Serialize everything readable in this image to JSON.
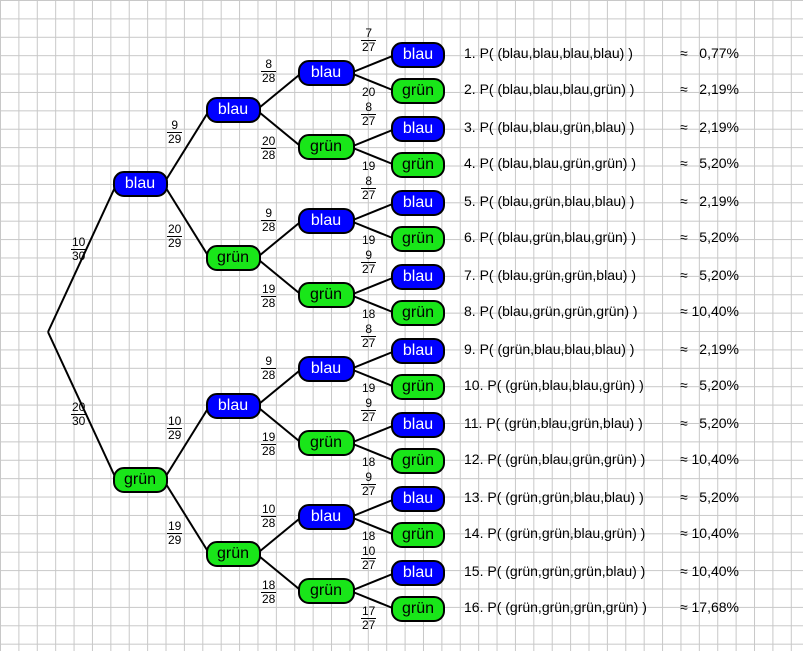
{
  "root_edges": [
    {
      "num": "10",
      "den": "30"
    },
    {
      "num": "20",
      "den": "30"
    }
  ],
  "level1": [
    {
      "label": "blau",
      "color": "blau"
    },
    {
      "label": "grün",
      "color": "gruen"
    }
  ],
  "level1_edges": [
    {
      "num": "9",
      "den": "29"
    },
    {
      "num": "20",
      "den": "29"
    },
    {
      "num": "10",
      "den": "29"
    },
    {
      "num": "19",
      "den": "29"
    }
  ],
  "level2": [
    {
      "label": "blau",
      "color": "blau"
    },
    {
      "label": "grün",
      "color": "gruen"
    },
    {
      "label": "blau",
      "color": "blau"
    },
    {
      "label": "grün",
      "color": "gruen"
    }
  ],
  "level2_edges": [
    {
      "num": "8",
      "den": "28"
    },
    {
      "num": "20",
      "den": "28"
    },
    {
      "num": "9",
      "den": "28"
    },
    {
      "num": "19",
      "den": "28"
    },
    {
      "num": "9",
      "den": "28"
    },
    {
      "num": "19",
      "den": "28"
    },
    {
      "num": "10",
      "den": "28"
    },
    {
      "num": "18",
      "den": "28"
    }
  ],
  "level3": [
    {
      "label": "blau",
      "color": "blau"
    },
    {
      "label": "grün",
      "color": "gruen"
    },
    {
      "label": "blau",
      "color": "blau"
    },
    {
      "label": "grün",
      "color": "gruen"
    },
    {
      "label": "blau",
      "color": "blau"
    },
    {
      "label": "grün",
      "color": "gruen"
    },
    {
      "label": "blau",
      "color": "blau"
    },
    {
      "label": "grün",
      "color": "gruen"
    }
  ],
  "level3_edges": [
    {
      "num": "7",
      "den": "27"
    },
    {
      "num": "20",
      "den": ""
    },
    {
      "num": "8",
      "den": "27"
    },
    {
      "num": "19",
      "den": ""
    },
    {
      "num": "8",
      "den": "27"
    },
    {
      "num": "19",
      "den": ""
    },
    {
      "num": "9",
      "den": "27"
    },
    {
      "num": "18",
      "den": ""
    },
    {
      "num": "8",
      "den": "27"
    },
    {
      "num": "19",
      "den": ""
    },
    {
      "num": "9",
      "den": "27"
    },
    {
      "num": "18",
      "den": ""
    },
    {
      "num": "9",
      "den": "27"
    },
    {
      "num": "18",
      "den": ""
    },
    {
      "num": "10",
      "den": "27"
    },
    {
      "num": "17",
      "den": "27"
    }
  ],
  "leaves": [
    {
      "label": "blau",
      "color": "blau"
    },
    {
      "label": "grün",
      "color": "gruen"
    },
    {
      "label": "blau",
      "color": "blau"
    },
    {
      "label": "grün",
      "color": "gruen"
    },
    {
      "label": "blau",
      "color": "blau"
    },
    {
      "label": "grün",
      "color": "gruen"
    },
    {
      "label": "blau",
      "color": "blau"
    },
    {
      "label": "grün",
      "color": "gruen"
    },
    {
      "label": "blau",
      "color": "blau"
    },
    {
      "label": "grün",
      "color": "gruen"
    },
    {
      "label": "blau",
      "color": "blau"
    },
    {
      "label": "grün",
      "color": "gruen"
    },
    {
      "label": "blau",
      "color": "blau"
    },
    {
      "label": "grün",
      "color": "gruen"
    },
    {
      "label": "blau",
      "color": "blau"
    },
    {
      "label": "grün",
      "color": "gruen"
    }
  ],
  "results": [
    {
      "text": "1. P( (blau,blau,blau,blau) )",
      "value": "≈   0,77%"
    },
    {
      "text": "2. P( (blau,blau,blau,grün) )",
      "value": "≈   2,19%"
    },
    {
      "text": "3. P( (blau,blau,grün,blau) )",
      "value": "≈   2,19%"
    },
    {
      "text": "4. P( (blau,blau,grün,grün) )",
      "value": "≈   5,20%"
    },
    {
      "text": "5. P( (blau,grün,blau,blau) )",
      "value": "≈   2,19%"
    },
    {
      "text": "6. P( (blau,grün,blau,grün) )",
      "value": "≈   5,20%"
    },
    {
      "text": "7. P( (blau,grün,grün,blau) )",
      "value": "≈   5,20%"
    },
    {
      "text": "8. P( (blau,grün,grün,grün) )",
      "value": "≈ 10,40%"
    },
    {
      "text": "9. P( (grün,blau,blau,blau) )",
      "value": "≈   2,19%"
    },
    {
      "text": "10. P( (grün,blau,blau,grün) )",
      "value": "≈   5,20%"
    },
    {
      "text": "11. P( (grün,blau,grün,blau) )",
      "value": "≈   5,20%"
    },
    {
      "text": "12. P( (grün,blau,grün,grün) )",
      "value": "≈ 10,40%"
    },
    {
      "text": "13. P( (grün,grün,blau,blau) )",
      "value": "≈   5,20%"
    },
    {
      "text": "14. P( (grün,grün,blau,grün) )",
      "value": "≈ 10,40%"
    },
    {
      "text": "15. P( (grün,grün,grün,blau) )",
      "value": "≈ 10,40%"
    },
    {
      "text": "16. P( (grün,grün,grün,grün) )",
      "value": "≈ 17,68%"
    }
  ]
}
